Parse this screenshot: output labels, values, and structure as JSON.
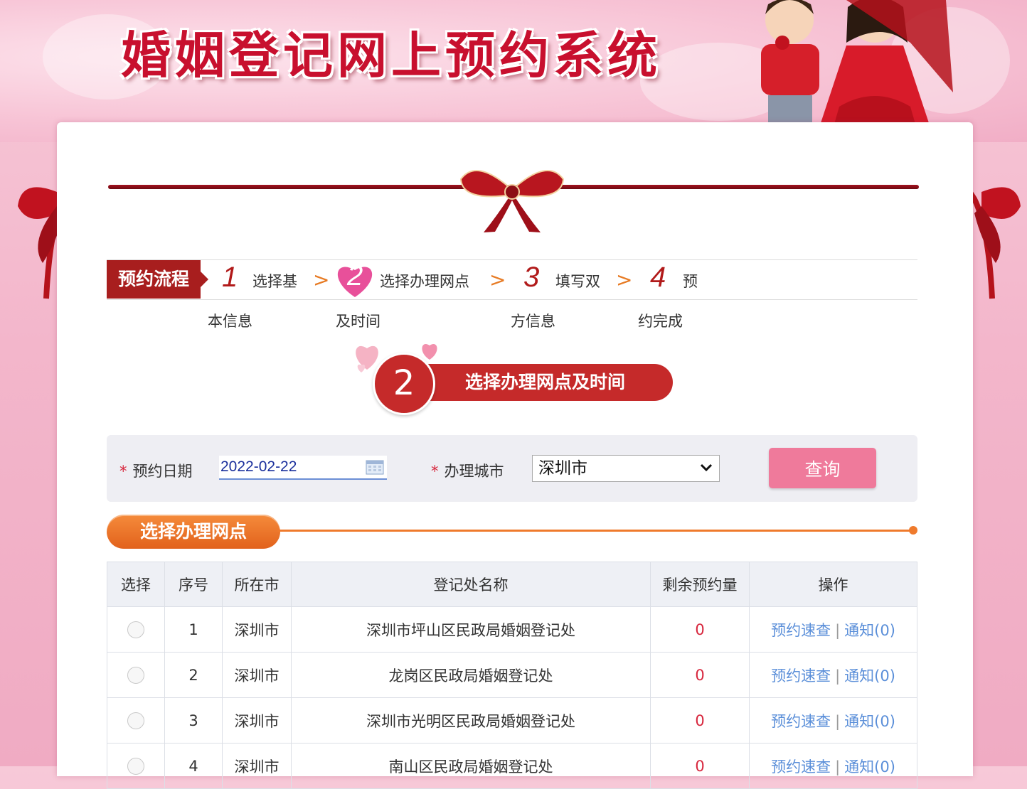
{
  "header": {
    "title": "婚姻登记网上预约系统"
  },
  "process": {
    "label": "预约流程",
    "steps": [
      {
        "num": "1",
        "line1": "选择基",
        "line2": "本信息"
      },
      {
        "num": "2",
        "line1": "选择办理网点",
        "line2": "及时间"
      },
      {
        "num": "3",
        "line1": "填写双",
        "line2": "方信息"
      },
      {
        "num": "4",
        "line1": "预",
        "line2": "约完成"
      }
    ],
    "arrow": ">"
  },
  "current_step": {
    "num": "2",
    "title": "选择办理网点及时间"
  },
  "search": {
    "required_mark": "*",
    "date_label": "预约日期",
    "date_value": "2022-02-22",
    "city_label": "办理城市",
    "city_value": "深圳市",
    "query_label": "查询"
  },
  "section": {
    "title": "选择办理网点"
  },
  "table": {
    "headers": [
      "选择",
      "序号",
      "所在市",
      "登记处名称",
      "剩余预约量",
      "操作"
    ],
    "rows": [
      {
        "no": "1",
        "city": "深圳市",
        "name": "深圳市坪山区民政局婚姻登记处",
        "remain": "0",
        "op1": "预约速查",
        "op2": "通知(0)"
      },
      {
        "no": "2",
        "city": "深圳市",
        "name": "龙岗区民政局婚姻登记处",
        "remain": "0",
        "op1": "预约速查",
        "op2": "通知(0)"
      },
      {
        "no": "3",
        "city": "深圳市",
        "name": "深圳市光明区民政局婚姻登记处",
        "remain": "0",
        "op1": "预约速查",
        "op2": "通知(0)"
      },
      {
        "no": "4",
        "city": "深圳市",
        "name": "南山区民政局婚姻登记处",
        "remain": "0",
        "op1": "预约速查",
        "op2": "通知(0)"
      }
    ],
    "sep": "|"
  },
  "colors": {
    "brand_red": "#c52a2a",
    "accent_orange": "#ef7a2c",
    "button_pink": "#ef7a9b",
    "link_blue": "#5b8fd9"
  }
}
